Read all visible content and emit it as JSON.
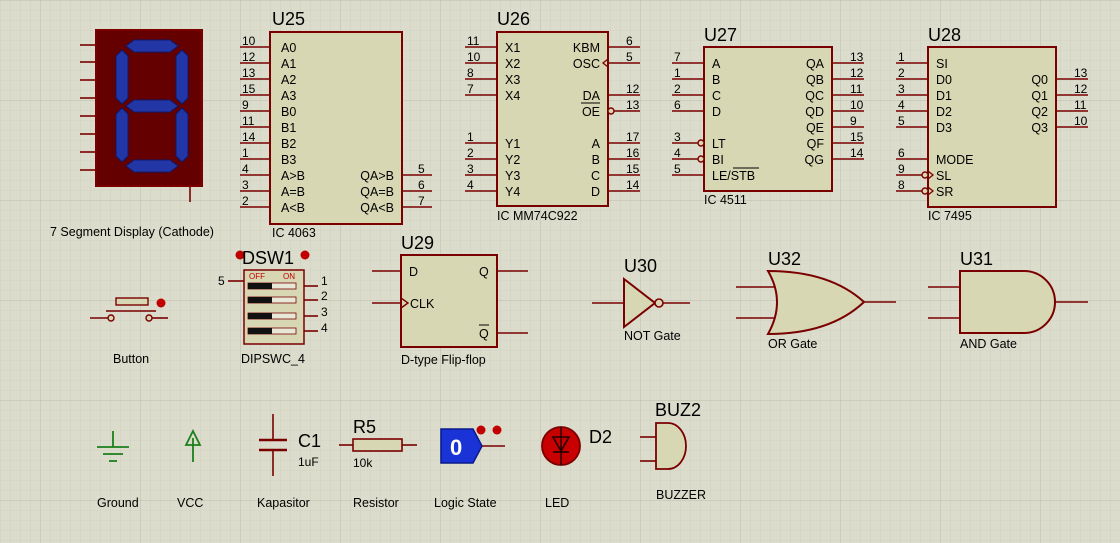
{
  "components": {
    "seg": {
      "label": "7 Segment Display (Cathode)"
    },
    "u25": {
      "ref": "U25",
      "label": "IC 4063",
      "left": [
        [
          "10",
          "A0"
        ],
        [
          "12",
          "A1"
        ],
        [
          "13",
          "A2"
        ],
        [
          "15",
          "A3"
        ],
        [
          "9",
          "B0"
        ],
        [
          "11",
          "B1"
        ],
        [
          "14",
          "B2"
        ],
        [
          "1",
          "B3"
        ],
        [
          "4",
          "A>B"
        ],
        [
          "3",
          "A=B"
        ],
        [
          "2",
          "A<B"
        ]
      ],
      "right": [
        [
          "5",
          "QA>B"
        ],
        [
          "6",
          "QA=B"
        ],
        [
          "7",
          "QA<B"
        ]
      ]
    },
    "u26": {
      "ref": "U26",
      "label": "IC MM74C922",
      "left": [
        [
          "11",
          "X1"
        ],
        [
          "10",
          "X2"
        ],
        [
          "8",
          "X3"
        ],
        [
          "7",
          "X4"
        ],
        [
          "1",
          "Y1"
        ],
        [
          "2",
          "Y2"
        ],
        [
          "3",
          "Y3"
        ],
        [
          "4",
          "Y4"
        ]
      ],
      "right": [
        [
          "6",
          "KBM"
        ],
        [
          "5",
          "OSC"
        ],
        [
          "12",
          "DA"
        ],
        [
          "13",
          "OE"
        ],
        [
          "17",
          "A"
        ],
        [
          "16",
          "B"
        ],
        [
          "15",
          "C"
        ],
        [
          "14",
          "D"
        ]
      ]
    },
    "u27": {
      "ref": "U27",
      "label": "IC 4511",
      "left": [
        [
          "7",
          "A"
        ],
        [
          "1",
          "B"
        ],
        [
          "2",
          "C"
        ],
        [
          "6",
          "D"
        ],
        [
          "3",
          "LT"
        ],
        [
          "4",
          "BI"
        ],
        [
          "5",
          "LE/STB"
        ]
      ],
      "right": [
        [
          "13",
          "QA"
        ],
        [
          "12",
          "QB"
        ],
        [
          "11",
          "QC"
        ],
        [
          "10",
          "QD"
        ],
        [
          "9",
          "QE"
        ],
        [
          "15",
          "QF"
        ],
        [
          "14",
          "QG"
        ]
      ]
    },
    "u28": {
      "ref": "U28",
      "label": "IC 7495",
      "left": [
        [
          "1",
          "SI"
        ],
        [
          "2",
          "D0"
        ],
        [
          "3",
          "D1"
        ],
        [
          "4",
          "D2"
        ],
        [
          "5",
          "D3"
        ],
        [
          "6",
          "MODE"
        ],
        [
          "9",
          "SL"
        ],
        [
          "8",
          "SR"
        ]
      ],
      "right": [
        [
          "13",
          "Q0"
        ],
        [
          "12",
          "Q1"
        ],
        [
          "11",
          "Q2"
        ],
        [
          "10",
          "Q3"
        ]
      ]
    },
    "dsw1": {
      "ref": "DSW1",
      "label": "DIPSWC_4",
      "off": "OFF",
      "on": "ON",
      "common_pin": "5",
      "pins": [
        "1",
        "2",
        "3",
        "4"
      ]
    },
    "u29": {
      "ref": "U29",
      "label": "D-type Flip-flop",
      "d": "D",
      "clk": "CLK",
      "q": "Q",
      "qbar": "Q"
    },
    "u30": {
      "ref": "U30",
      "label": "NOT Gate"
    },
    "u32": {
      "ref": "U32",
      "label": "OR Gate"
    },
    "u31": {
      "ref": "U31",
      "label": "AND Gate"
    },
    "button": {
      "label": "Button"
    },
    "ground": {
      "label": "Ground"
    },
    "vcc": {
      "label": "VCC"
    },
    "c1": {
      "ref": "C1",
      "value": "1uF",
      "label": "Kapasitor"
    },
    "r5": {
      "ref": "R5",
      "value": "10k",
      "label": "Resistor"
    },
    "logic": {
      "value": "0",
      "label": "Logic State"
    },
    "d2": {
      "ref": "D2",
      "label": "LED"
    },
    "buz2": {
      "ref": "BUZ2",
      "label": "BUZZER"
    }
  },
  "colors": {
    "background": "#dcdccc",
    "grid": "#c4c4b4",
    "body": "#d7d7b4",
    "outline": "#7a0000",
    "segment_off": "#650000",
    "segment_on": "#2336a6",
    "logic_state": "#1a33d6",
    "led_red": "#c80000",
    "ground_green": "#1b7f1b"
  }
}
